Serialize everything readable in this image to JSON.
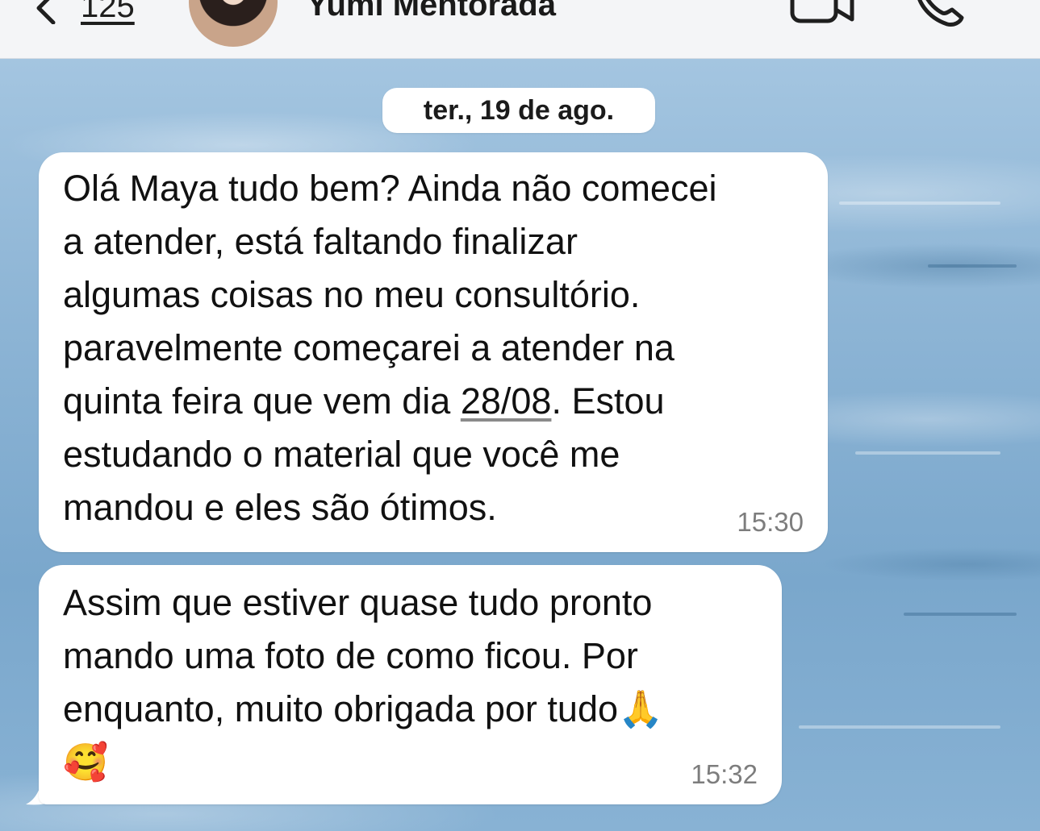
{
  "header": {
    "back_count": "125",
    "contact_name": "Yumi Mentorada",
    "back_icon": "chevron-left-icon",
    "video_icon": "video-camera-icon",
    "call_icon": "phone-icon"
  },
  "chat": {
    "date_separator": "ter., 19 de ago.",
    "messages": [
      {
        "text_before": "Olá Maya tudo bem? Ainda não comecei\na atender, está faltando finalizar\nalgumas coisas no meu consultório.\nparavelmente começarei a atender na\nquinta feira que vem dia ",
        "date_link": "28/08",
        "text_after": ". Estou\nestudando o material que você me\nmandou e eles são ótimos.",
        "time": "15:30"
      },
      {
        "text": "Assim que estiver quase tudo pronto\nmando uma foto de como ficou. Por\nenquanto, muito obrigada por tudo🙏\n🥰",
        "time": "15:32"
      }
    ]
  },
  "colors": {
    "header_bg": "#f4f5f7",
    "bubble_bg": "#ffffff",
    "time_text": "#7d7d7d"
  }
}
